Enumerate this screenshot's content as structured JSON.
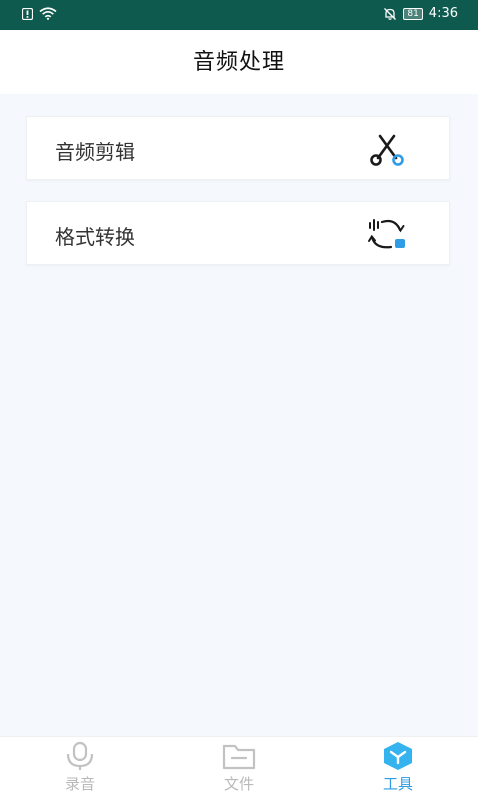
{
  "status_bar": {
    "time": "4:36",
    "battery": "81"
  },
  "header": {
    "title": "音频处理"
  },
  "tools": [
    {
      "label": "音频剪辑",
      "icon": "scissors-icon"
    },
    {
      "label": "格式转换",
      "icon": "convert-icon"
    }
  ],
  "tabbar": {
    "items": [
      {
        "label": "录音",
        "icon": "microphone-icon",
        "active": false
      },
      {
        "label": "文件",
        "icon": "folder-icon",
        "active": false
      },
      {
        "label": "工具",
        "icon": "toolbox-icon",
        "active": true
      }
    ]
  },
  "colors": {
    "status_bar": "#0f5a4e",
    "accent": "#2f9ce5",
    "inactive": "#b9b9b9",
    "background": "#f5f9fd"
  }
}
